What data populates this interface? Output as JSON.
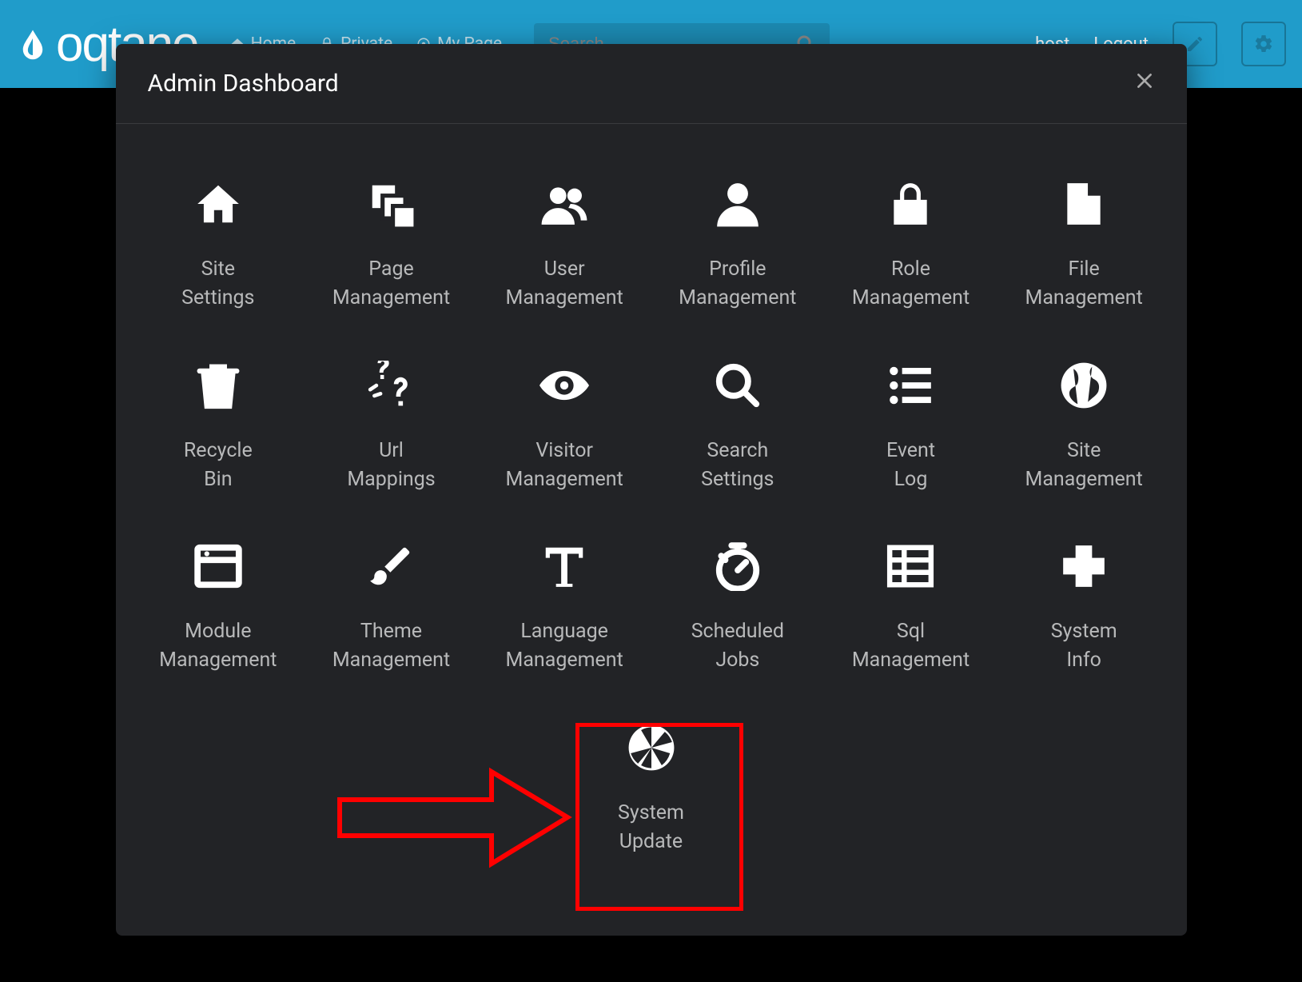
{
  "topbar": {
    "logo_text": "oqtane",
    "nav": [
      {
        "label": "Home",
        "icon": "home"
      },
      {
        "label": "Private",
        "icon": "lock"
      },
      {
        "label": "My Page",
        "icon": "target"
      }
    ],
    "search_placeholder": "Search",
    "user_link": "host",
    "logout_link": "Logout"
  },
  "modal": {
    "title": "Admin Dashboard",
    "items": [
      {
        "id": "site-settings",
        "label": "Site\nSettings",
        "icon": "home"
      },
      {
        "id": "page-management",
        "label": "Page\nManagement",
        "icon": "layers"
      },
      {
        "id": "user-management",
        "label": "User\nManagement",
        "icon": "users"
      },
      {
        "id": "profile-management",
        "label": "Profile\nManagement",
        "icon": "person"
      },
      {
        "id": "role-management",
        "label": "Role\nManagement",
        "icon": "lock"
      },
      {
        "id": "file-management",
        "label": "File\nManagement",
        "icon": "file"
      },
      {
        "id": "recycle-bin",
        "label": "Recycle\nBin",
        "icon": "trash"
      },
      {
        "id": "url-mappings",
        "label": "Url\nMappings",
        "icon": "question"
      },
      {
        "id": "visitor-management",
        "label": "Visitor\nManagement",
        "icon": "eye"
      },
      {
        "id": "search-settings",
        "label": "Search\nSettings",
        "icon": "search"
      },
      {
        "id": "event-log",
        "label": "Event\nLog",
        "icon": "list"
      },
      {
        "id": "site-management",
        "label": "Site\nManagement",
        "icon": "globe"
      },
      {
        "id": "module-management",
        "label": "Module\nManagement",
        "icon": "window"
      },
      {
        "id": "theme-management",
        "label": "Theme\nManagement",
        "icon": "brush"
      },
      {
        "id": "language-management",
        "label": "Language\nManagement",
        "icon": "text"
      },
      {
        "id": "scheduled-jobs",
        "label": "Scheduled\nJobs",
        "icon": "timer"
      },
      {
        "id": "sql-management",
        "label": "Sql\nManagement",
        "icon": "spreadsheet"
      },
      {
        "id": "system-info",
        "label": "System\nInfo",
        "icon": "plus"
      },
      {
        "id": "system-update",
        "label": "System\nUpdate",
        "icon": "aperture"
      }
    ]
  },
  "annotation": {
    "highlighted_item": "system-update"
  }
}
